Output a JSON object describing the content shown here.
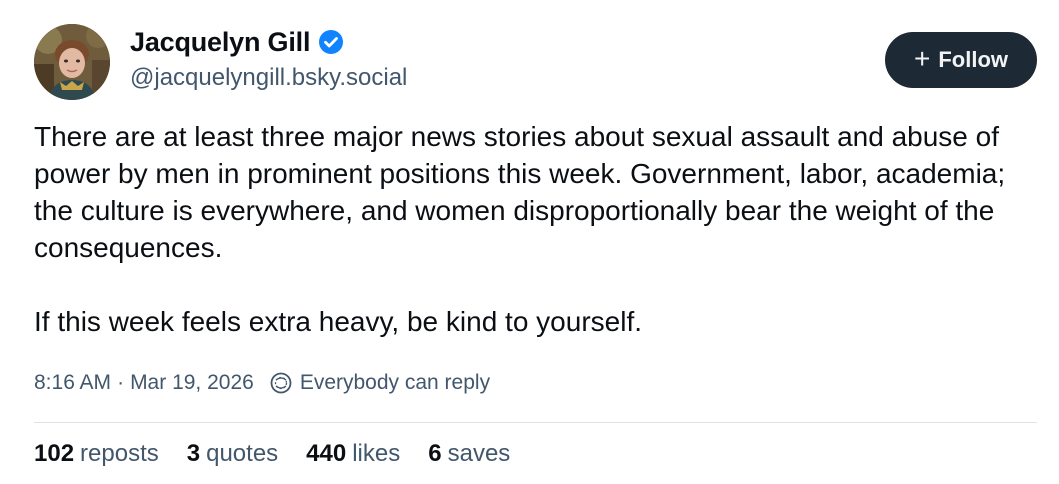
{
  "author": {
    "display_name": "Jacquelyn Gill",
    "handle": "@jacquelyngill.bsky.social",
    "verified": true
  },
  "actions": {
    "follow_label": "Follow"
  },
  "post": {
    "paragraphs": [
      "There are at least three major news stories about sexual assault and abuse of power by men in prominent positions this week. Government, labor, academia; the culture is everywhere, and women disproportionally bear the weight of the consequences.",
      "If this week feels extra heavy, be kind to yourself."
    ],
    "time": "8:16 AM",
    "separator": "·",
    "date": "Mar 19, 2026",
    "reply_setting": "Everybody can reply"
  },
  "stats": [
    {
      "count": "102",
      "label": "reposts"
    },
    {
      "count": "3",
      "label": "quotes"
    },
    {
      "count": "440",
      "label": "likes"
    },
    {
      "count": "6",
      "label": "saves"
    }
  ],
  "colors": {
    "verified": "#1083fe",
    "follow_bg": "#1e2936",
    "muted_text": "#42576c",
    "divider": "#dfe3e8"
  }
}
